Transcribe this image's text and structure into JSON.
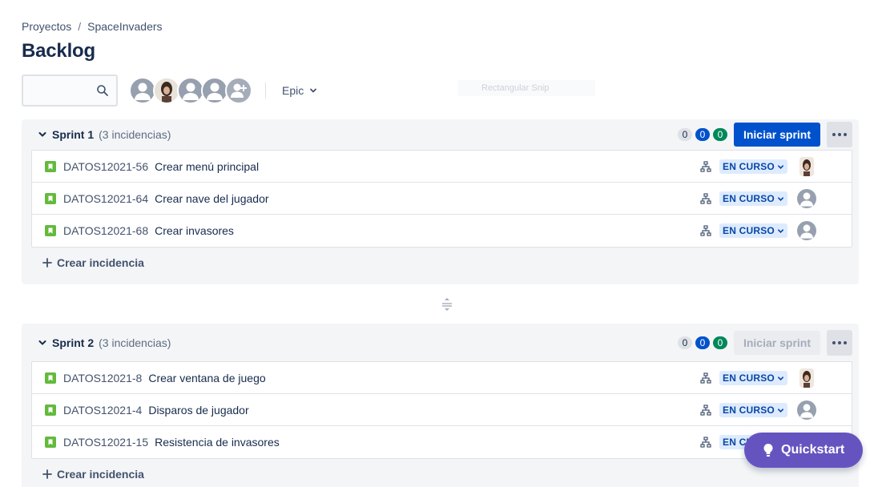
{
  "breadcrumb": {
    "root": "Proyectos",
    "separator": "/",
    "project": "SpaceInvaders"
  },
  "page": {
    "title": "Backlog"
  },
  "search": {
    "value": "",
    "placeholder": ""
  },
  "filters": {
    "epic_label": "Epic",
    "faded_label": "Rectangular Snip"
  },
  "colors": {
    "primary": "#0052cc",
    "status_bg": "#deebff",
    "story": "#63ba3c",
    "quickstart": "#6554c0"
  },
  "sprints": [
    {
      "name": "Sprint 1",
      "count": "(3 incidencias)",
      "pills": [
        "0",
        "0",
        "0"
      ],
      "start_label": "Iniciar sprint",
      "issues": [
        {
          "key": "DATOS12021-56",
          "summary": "Crear menú principal",
          "status": "EN CURSO",
          "assignee": "photo"
        },
        {
          "key": "DATOS12021-64",
          "summary": "Crear nave del jugador",
          "status": "EN CURSO",
          "assignee": "default"
        },
        {
          "key": "DATOS12021-68",
          "summary": "Crear invasores",
          "status": "EN CURSO",
          "assignee": "default"
        }
      ],
      "create_label": "Crear incidencia"
    },
    {
      "name": "Sprint 2",
      "count": "(3 incidencias)",
      "pills": [
        "0",
        "0",
        "0"
      ],
      "start_label": "Iniciar sprint",
      "issues": [
        {
          "key": "DATOS12021-8",
          "summary": "Crear ventana de juego",
          "status": "EN CURSO",
          "assignee": "photo"
        },
        {
          "key": "DATOS12021-4",
          "summary": "Disparos de jugador",
          "status": "EN CURSO",
          "assignee": "default"
        },
        {
          "key": "DATOS12021-15",
          "summary": "Resistencia de invasores",
          "status": "EN CURSO",
          "assignee": "default"
        }
      ],
      "create_label": "Crear incidencia"
    }
  ],
  "quickstart": {
    "label": "Quickstart"
  }
}
